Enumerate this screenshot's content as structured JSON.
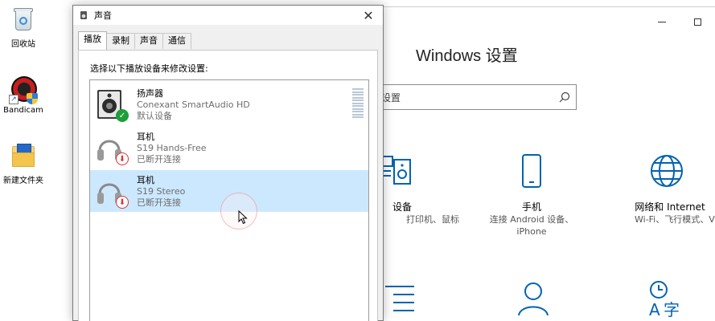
{
  "desktop": {
    "icons": [
      {
        "label": "回收站",
        "icon": "recycle-bin-icon"
      },
      {
        "label": "Bandicam",
        "icon": "bandicam-icon"
      },
      {
        "label": "新建文件夹",
        "icon": "folder-icon"
      }
    ]
  },
  "settings": {
    "title": "Windows 设置",
    "search_value": "设置",
    "categories": [
      {
        "name": "设备",
        "desc": "打印机、鼠标",
        "icon": "devices-icon"
      },
      {
        "name": "手机",
        "desc_line1": "连接 Android 设备、",
        "desc_line2": "iPhone",
        "icon": "phone-icon"
      },
      {
        "name": "网络和 Internet",
        "desc": "Wi-Fi、飞行模式、VPN",
        "icon": "globe-icon"
      },
      {
        "icon": "personalization-icon"
      },
      {
        "icon": "accounts-icon"
      },
      {
        "icon": "time-language-icon"
      }
    ]
  },
  "sound_dialog": {
    "title": "声音",
    "tabs": [
      "播放",
      "录制",
      "声音",
      "通信"
    ],
    "active_tab": 0,
    "instruction": "选择以下播放设备来修改设置:",
    "devices": [
      {
        "name": "扬声器",
        "driver": "Conexant SmartAudio HD",
        "status": "默认设备",
        "icon": "speaker-icon",
        "badge": "default-check-icon"
      },
      {
        "name": "耳机",
        "driver": "S19 Hands-Free",
        "status": "已断开连接",
        "icon": "headphones-icon",
        "badge": "disconnected-arrow-icon"
      },
      {
        "name": "耳机",
        "driver": "S19 Stereo",
        "status": "已断开连接",
        "icon": "headphones-icon",
        "badge": "disconnected-arrow-icon",
        "selected": true
      }
    ]
  },
  "colors": {
    "selection": "#cce8ff",
    "accent_blue": "#0063b1",
    "default_green": "#1e9e3a",
    "disconnected_red": "#d33333"
  }
}
